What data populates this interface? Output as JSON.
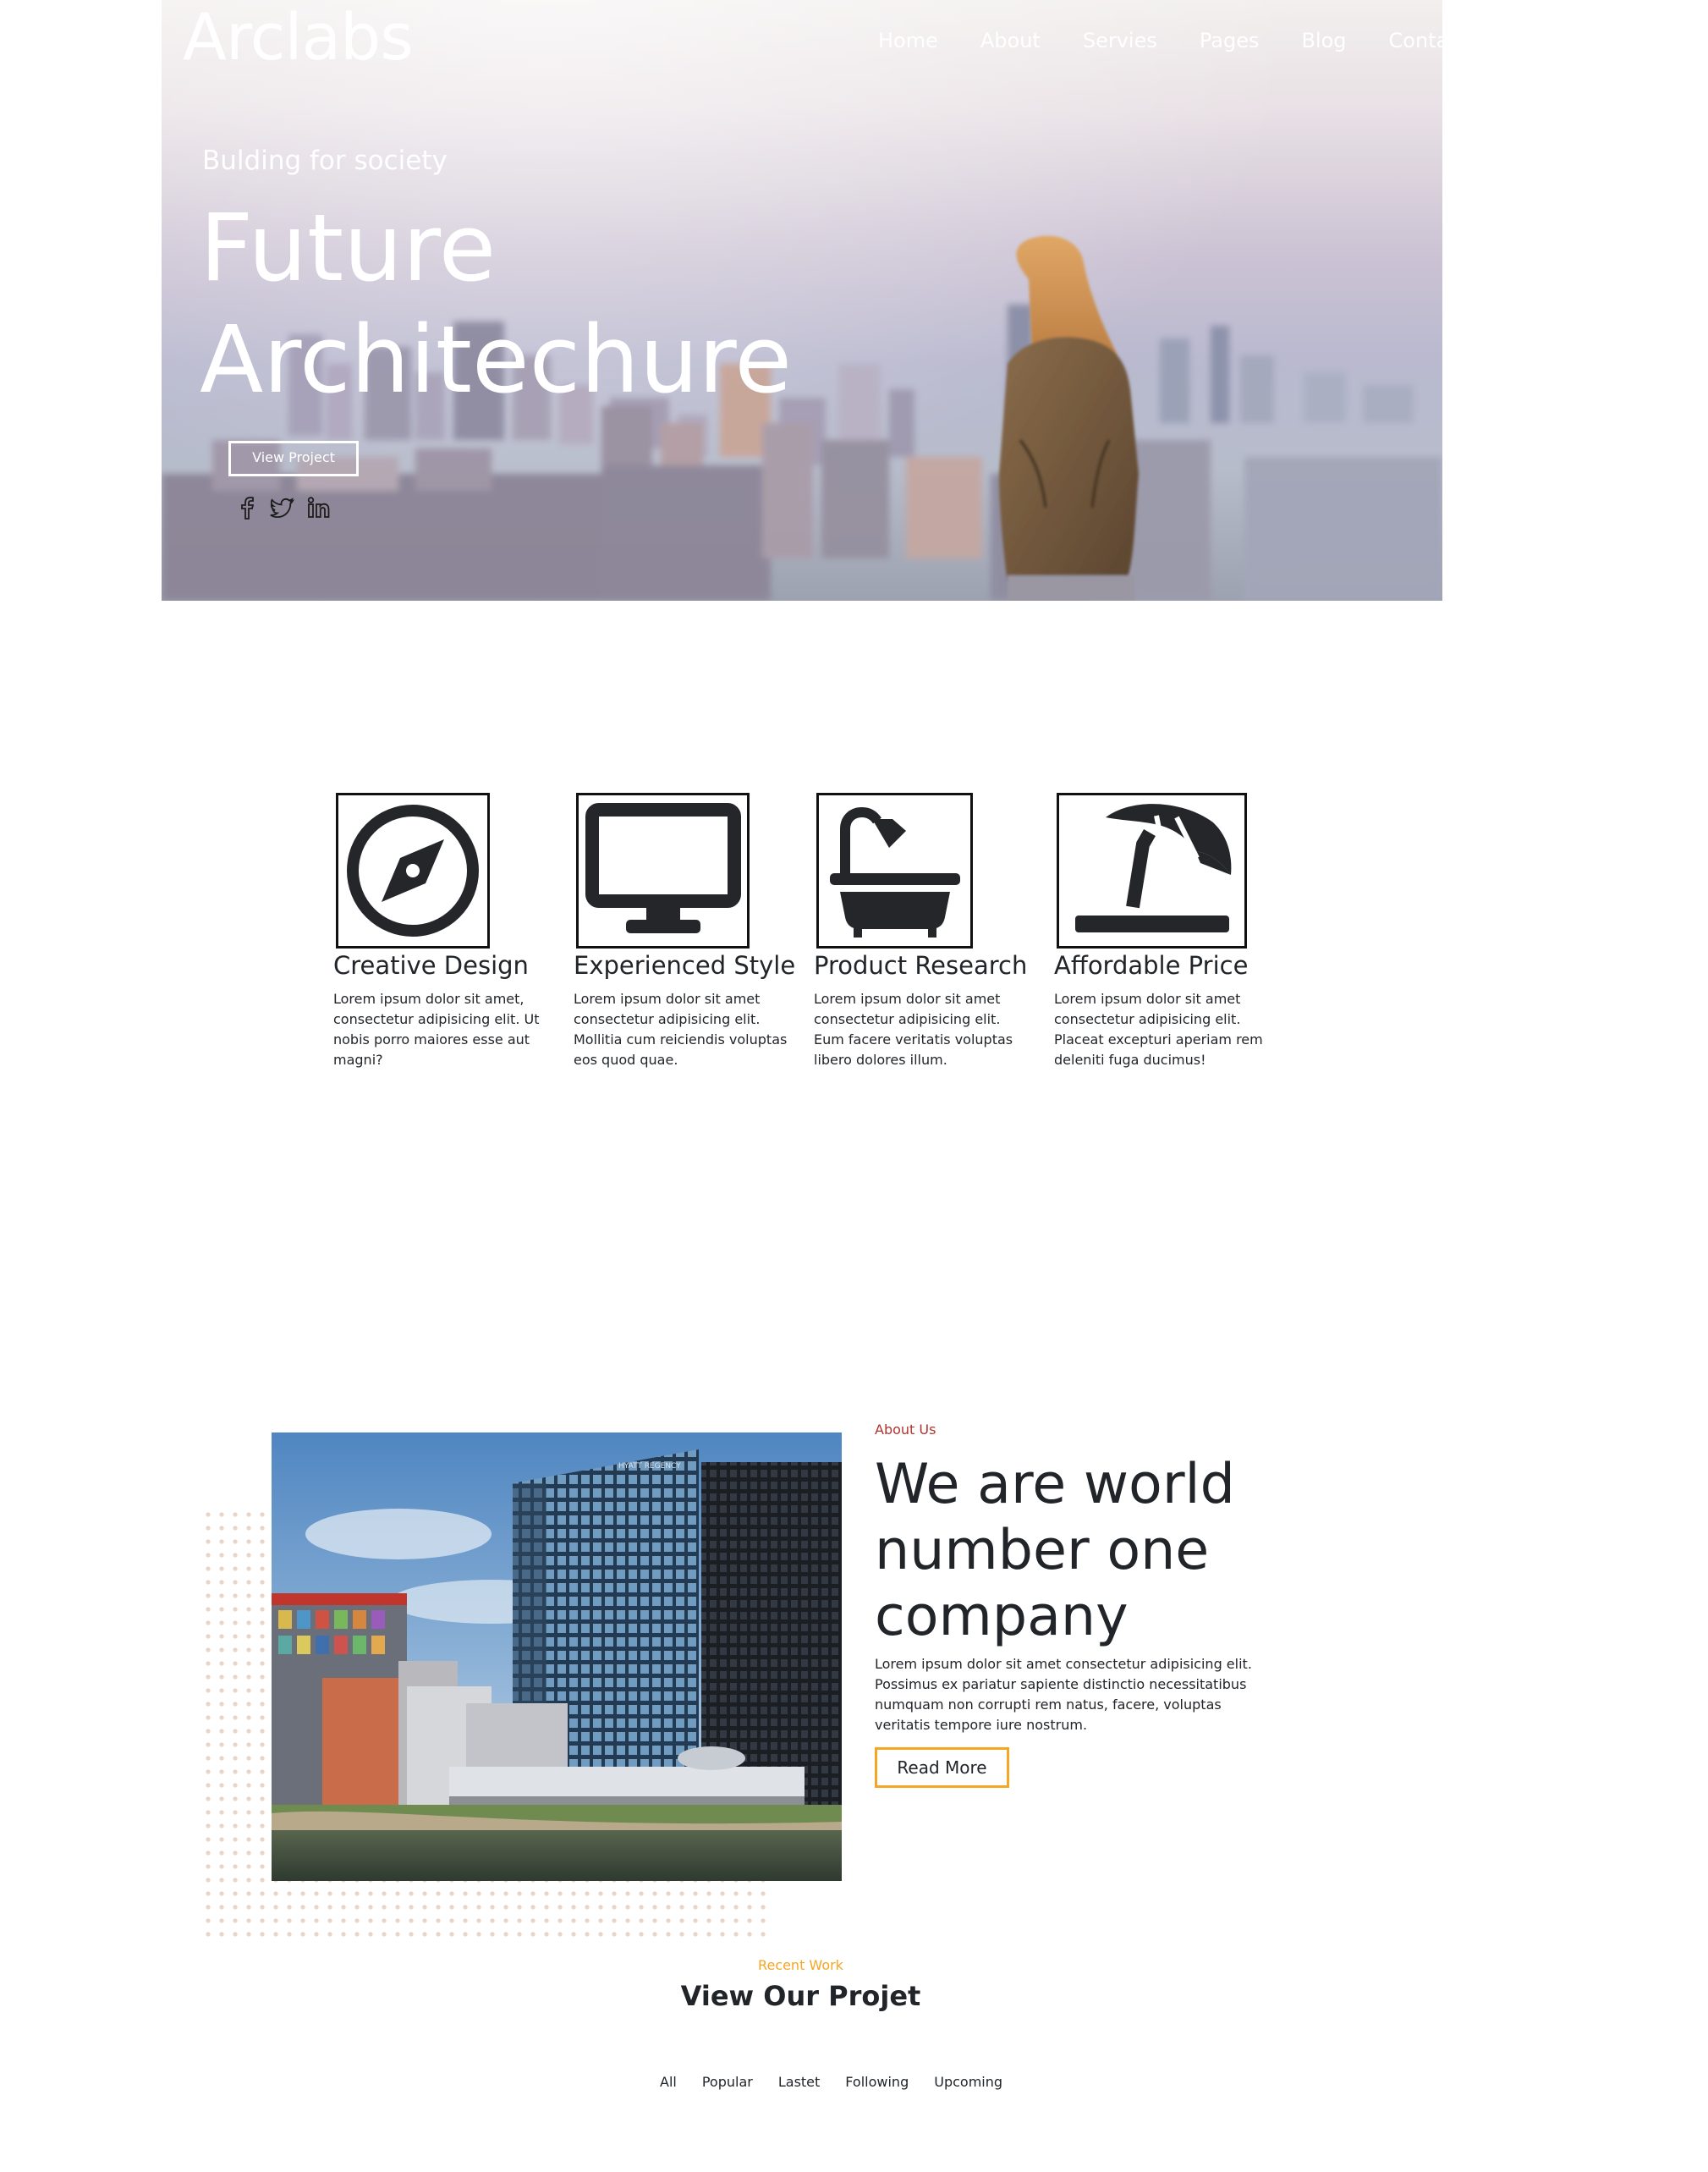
{
  "header": {
    "logo": "Arclabs",
    "nav": [
      "Home",
      "About",
      "Servies",
      "Pages",
      "Blog",
      "Contact"
    ]
  },
  "hero": {
    "subtitle": "Bulding for society",
    "title_line1": "Future",
    "title_line2": "Architechure",
    "button": "View Project",
    "social_icons": [
      "facebook-icon",
      "twitter-icon",
      "linkedin-icon"
    ]
  },
  "features": [
    {
      "icon": "compass-icon",
      "title": "Creative Design",
      "description": "Lorem ipsum dolor sit amet, consectetur adipisicing elit. Ut nobis porro maiores esse aut magni?"
    },
    {
      "icon": "desktop-icon",
      "title": "Experienced Style",
      "description": "Lorem ipsum dolor sit amet consectetur adipisicing elit. Mollitia cum reiciendis voluptas eos quod quae."
    },
    {
      "icon": "bath-icon",
      "title": "Product Research",
      "description": "Lorem ipsum dolor sit amet consectetur adipisicing elit. Eum facere veritatis voluptas libero dolores illum."
    },
    {
      "icon": "umbrella-beach-icon",
      "title": "Affordable Price",
      "description": "Lorem ipsum dolor sit amet consectetur adipisicing elit. Placeat excepturi aperiam rem deleniti fuga ducimus!"
    }
  ],
  "about": {
    "label": "About Us",
    "heading": "We are world number one company",
    "text": "Lorem ipsum dolor sit amet consectetur adipisicing elit. Possimus ex pariatur sapiente distinctio necessitatibus numquam non corrupti rem natus, facere, voluptas veritatis tempore iure nostrum.",
    "button": "Read More",
    "building_sign": "HYATT REGENCY"
  },
  "projects": {
    "label": "Recent Work",
    "title": "View Our Projet",
    "filters": [
      "All",
      "Popular",
      "Lastet",
      "Following",
      "Upcoming"
    ]
  },
  "colors": {
    "accent_orange": "#f5a623",
    "about_label_red": "#b0332e",
    "text_dark": "#212529"
  }
}
